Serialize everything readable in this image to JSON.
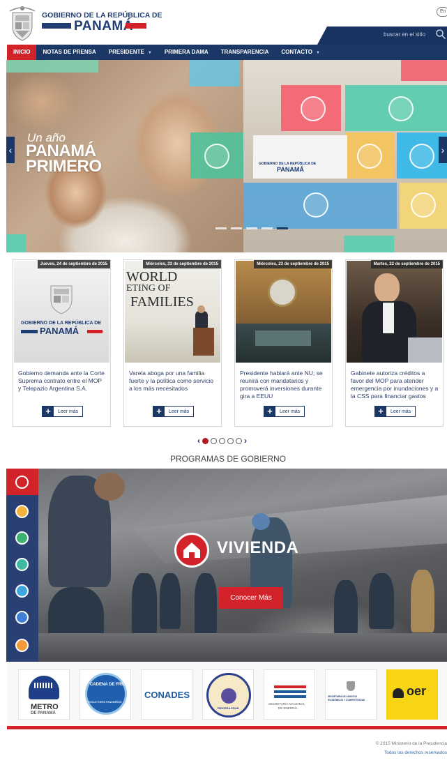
{
  "header": {
    "gov_line1": "GOBIERNO DE LA REPÚBLICA DE",
    "gov_line2": "PANAMÁ",
    "lang": "En",
    "search_placeholder": "buscar en el sitio"
  },
  "nav": {
    "items": [
      {
        "label": "INICIO",
        "active": true,
        "dropdown": false
      },
      {
        "label": "NOTAS DE PRENSA",
        "active": false,
        "dropdown": false
      },
      {
        "label": "PRESIDENTE",
        "active": false,
        "dropdown": true
      },
      {
        "label": "PRIMERA DAMA",
        "active": false,
        "dropdown": false
      },
      {
        "label": "TRANSPARENCIA",
        "active": false,
        "dropdown": false
      },
      {
        "label": "CONTACTO",
        "active": false,
        "dropdown": true
      }
    ]
  },
  "hero": {
    "tag_small": "Un año",
    "tag_line1": "PANAMÁ",
    "tag_line2": "PRIMERO",
    "card_line1": "GOBIERNO DE LA REPÚBLICA DE",
    "card_line2": "PANAMÁ",
    "slide_count": 5,
    "active_slide": 4
  },
  "news": [
    {
      "date": "Jueves, 24 de septiembre de 2015",
      "text": "Gobierno demanda ante la Corte Suprema contrato entre el MOP y Telepazio Argentina S.A.",
      "image": "gobierno-seal",
      "img_line1": "GOBIERNO DE LA REPÚBLICA DE",
      "img_line2": "PANAMÁ",
      "read_more": "Leer más"
    },
    {
      "date": "Miércoles, 23 de septiembre de 2015",
      "text": "Varela aboga por una familia fuerte y la política como servicio a los más necesitados",
      "image": "world-meeting-families",
      "img_line1": "WORLD",
      "img_line2": "ETING OF",
      "img_line3": "FAMILIES",
      "read_more": "Leer más"
    },
    {
      "date": "Miércoles, 23 de septiembre de 2015",
      "text": "Presidente hablará ante NU; se reunirá con mandatarios y promoverá inversiones durante gira a EEUU",
      "image": "un-assembly",
      "read_more": "Leer más"
    },
    {
      "date": "Martes, 22 de septiembre de 2015",
      "text": "Gabinete autoriza créditos a favor del MOP para atender emergencia por inundaciones y a la CSS para financiar gastos",
      "image": "cabinet-press",
      "read_more": "Leer más"
    }
  ],
  "pager": {
    "count": 5,
    "active": 0
  },
  "programs": {
    "title": "PROGRAMAS DE GOBIERNO",
    "current": "VIVIENDA",
    "button": "Conocer Más",
    "icons": [
      "home-icon",
      "bag-icon",
      "book-icon",
      "family-icon",
      "water-icon",
      "shield-icon",
      "phone-icon"
    ]
  },
  "logos": [
    {
      "name": "metro-de-panama",
      "line1": "METRO",
      "line2": "DE PANAMÁ"
    },
    {
      "name": "cadena-de-frio",
      "line1": "CADENA DE FRÍO",
      "line2": "PRODUCTORES PANAMEÑOS"
    },
    {
      "name": "conades",
      "line1": "CONADES"
    },
    {
      "name": "secretaria-tercera-edad",
      "line1": "TERCERA EDAD"
    },
    {
      "name": "secretaria-energia",
      "line1": "SECRETARÍA NACIONAL",
      "line2": "DE ENERGÍA"
    },
    {
      "name": "ministerio-economicos",
      "line1": "SECRETARÍA DE ASUNTOS",
      "line2": "ECONÓMICOS Y COMPETITIVIDAD"
    },
    {
      "name": "oer",
      "line1": "oer"
    }
  ],
  "footer": {
    "line1": "© 2015 Ministerio de la Presidencia",
    "line2": "Todos los derechos reservados"
  },
  "colors": {
    "navy": "#1a3766",
    "red": "#d2232a",
    "dark_navy": "#18335f"
  }
}
